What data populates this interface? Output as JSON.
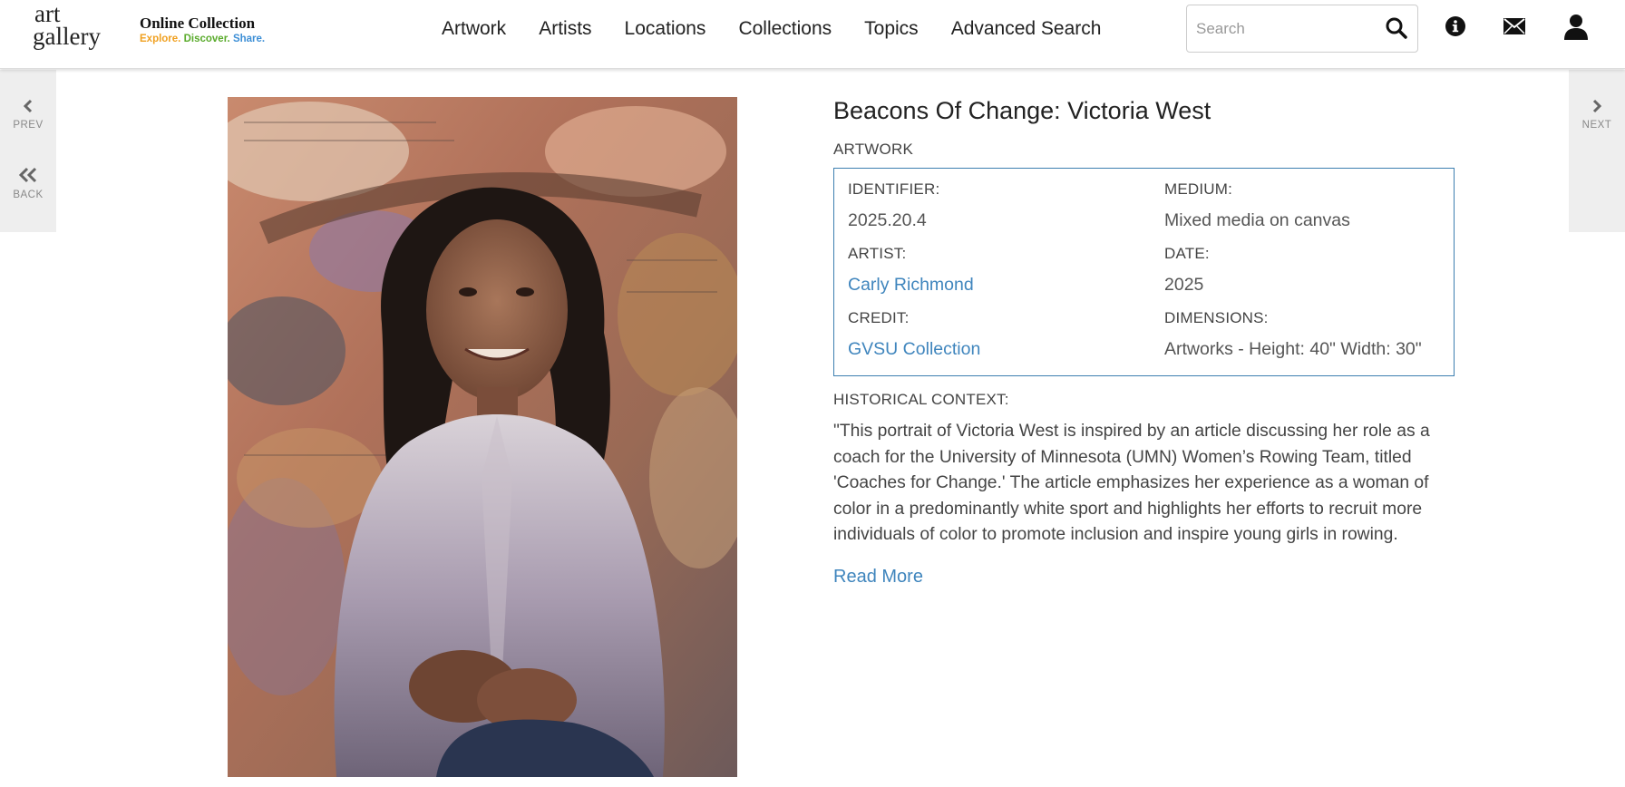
{
  "header": {
    "logo": {
      "line1": "art",
      "line2": "gallery"
    },
    "tagline": {
      "title": "Online Collection",
      "word1": "Explore.",
      "word2": "Discover.",
      "word3": "Share."
    },
    "nav": [
      "Artwork",
      "Artists",
      "Locations",
      "Collections",
      "Topics",
      "Advanced Search"
    ],
    "search": {
      "placeholder": "Search",
      "value": ""
    },
    "icons": [
      "search-icon",
      "info-icon",
      "mail-icon",
      "user-icon"
    ]
  },
  "sidenav": {
    "prev_label": "PREV",
    "back_label": "BACK",
    "next_label": "NEXT"
  },
  "artwork": {
    "title": "Beacons Of Change: Victoria West",
    "type": "ARTWORK",
    "identifier_label": "IDENTIFIER:",
    "identifier": "2025.20.4",
    "medium_label": "MEDIUM:",
    "medium": "Mixed media on canvas",
    "artist_label": "ARTIST:",
    "artist": "Carly Richmond",
    "date_label": "DATE:",
    "date": "2025",
    "credit_label": "CREDIT:",
    "credit": "GVSU Collection",
    "dimensions_label": "DIMENSIONS:",
    "dimensions": "Artworks - Height: 40\" Width: 30\"",
    "historical_context_label": "HISTORICAL CONTEXT:",
    "historical_context": "\"This portrait of Victoria West is inspired by an article discussing her role as a coach for the University of Minnesota (UMN) Women’s Rowing Team, titled 'Coaches for Change.' The article emphasizes her experience as a woman of color in a predominantly white sport and highlights her efforts to recruit more individuals of color to promote inclusion and inspire young girls in rowing.",
    "read_more": "Read More"
  },
  "colors": {
    "link": "#3f85bd",
    "box_border": "#3d7fb0",
    "tagline_explore": "#f0a020",
    "tagline_discover": "#5aab2c",
    "tagline_share": "#3d8fd6"
  }
}
